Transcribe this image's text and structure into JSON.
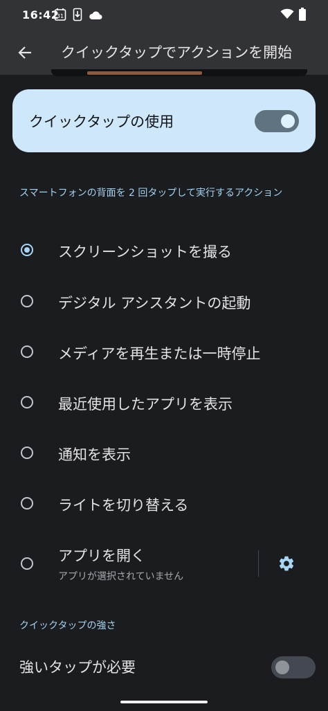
{
  "status_bar": {
    "time": "16:42",
    "calendar_day": "31",
    "icons": [
      "calendar-icon",
      "phone-download-icon",
      "cloud-icon",
      "wifi-icon",
      "battery-icon"
    ]
  },
  "app_bar": {
    "title": "クイックタップでアクションを開始",
    "back_icon": "arrow-back-icon"
  },
  "main_toggle": {
    "label": "クイックタップの使用",
    "enabled": true
  },
  "actions_section": {
    "header": "スマートフォンの背面を 2 回タップして実行するアクション",
    "options": [
      {
        "label": "スクリーンショットを撮る",
        "selected": true
      },
      {
        "label": "デジタル アシスタントの起動",
        "selected": false
      },
      {
        "label": "メディアを再生または一時停止",
        "selected": false
      },
      {
        "label": "最近使用したアプリを表示",
        "selected": false
      },
      {
        "label": "通知を表示",
        "selected": false
      },
      {
        "label": "ライトを切り替える",
        "selected": false
      },
      {
        "label": "アプリを開く",
        "sublabel": "アプリが選択されていません",
        "selected": false,
        "settings_icon": "gear-icon"
      }
    ]
  },
  "strength_section": {
    "header": "クイックタップの強さ",
    "toggle_label": "強いタップが必要",
    "enabled": false
  },
  "colors": {
    "background": "#1b1c20",
    "app_bar": "#323336",
    "card": "#cfe7fb",
    "accent": "#a9d4f4",
    "section_header": "#a6d1ee"
  }
}
